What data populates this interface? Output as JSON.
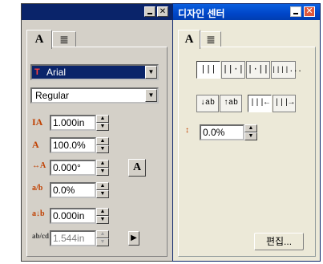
{
  "left_panel": {
    "title_buttons": {
      "minimize": "",
      "close": "✕"
    },
    "tabs": [
      {
        "label": "A"
      },
      {
        "label": "≣"
      }
    ],
    "font_name": "Arial",
    "font_style": "Regular",
    "fields": [
      {
        "icon": "IA",
        "value": "1.000in"
      },
      {
        "icon": "A",
        "value": "100.0%"
      },
      {
        "icon": "↔A",
        "value": "0.000°"
      },
      {
        "icon": "a/b",
        "value": "0.0%"
      },
      {
        "icon": "a↓b",
        "value": "0.000in"
      }
    ],
    "disabled_field": {
      "icon": "ab/cd",
      "value": "1.544in"
    },
    "apply_button": "A",
    "more_button": "▶"
  },
  "right_panel": {
    "title": "디자인 센터",
    "tabs": [
      {
        "label": "A"
      },
      {
        "label": "≣"
      }
    ],
    "align_tools": [
      "|||",
      "||·|",
      "|·||",
      "||||..."
    ],
    "direction_tools": [
      "↓ab",
      "↑ab",
      "|||←",
      "|||→"
    ],
    "indent_value": "0.0%",
    "edit_button": "편집..."
  }
}
